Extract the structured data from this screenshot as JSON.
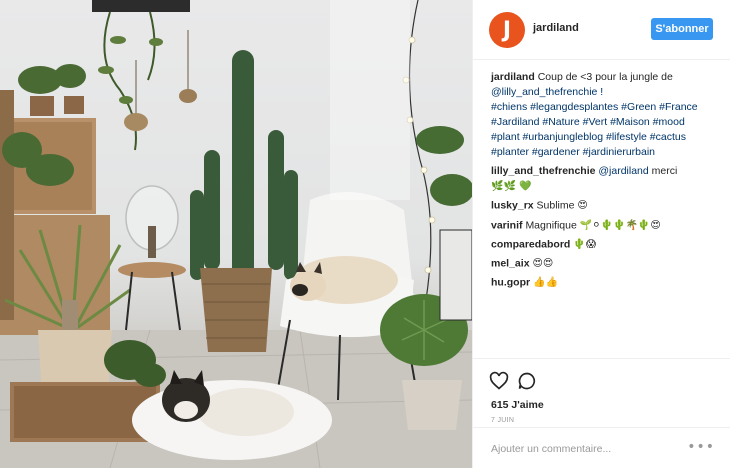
{
  "header": {
    "avatar_letter": "J",
    "username": "jardiland",
    "follow_label": "S'abonner"
  },
  "caption": {
    "username": "jardiland",
    "text_before": "Coup de <3 pour la jungle de",
    "mention": "@lilly_and_thefrenchie !",
    "hashtags_line1": "#chiens #legangdesplantes #Green #France",
    "hashtags_line2": "#Jardiland #Nature #Vert #Maison #mood",
    "hashtags_line3": "#plant #urbanjungleblog #lifestyle #cactus",
    "hashtags_line4": "#planter #gardener #jardinierurbain"
  },
  "comments": [
    {
      "user": "lilly_and_thefrenchie",
      "mention": "@jardiland",
      "text": "merci",
      "emoji": "🌿🌿 💚"
    },
    {
      "user": "lusky_rx",
      "text": "Sublime",
      "emoji": "😍"
    },
    {
      "user": "varinif",
      "text": "Magnifique",
      "emoji": "🌱⚪🌵🌵🌴🌵😍"
    },
    {
      "user": "comparedabord",
      "text": "",
      "emoji": "🌵😱"
    },
    {
      "user": "mel_aix",
      "text": "",
      "emoji": "😍😍"
    },
    {
      "user": "hu.gopr",
      "text": "",
      "emoji": "👍👍"
    }
  ],
  "actions": {
    "likes": "615 J'aime",
    "date": "7 JUIN",
    "comment_placeholder": "Ajouter un commentaire...",
    "more_glyph": "•••"
  },
  "colors": {
    "follow_blue": "#3897f0",
    "avatar_orange": "#e8531e",
    "hashtag_blue": "#003569"
  },
  "icons": {
    "like": "heart-icon",
    "comment": "comment-bubble-icon",
    "more": "more-options-icon"
  }
}
